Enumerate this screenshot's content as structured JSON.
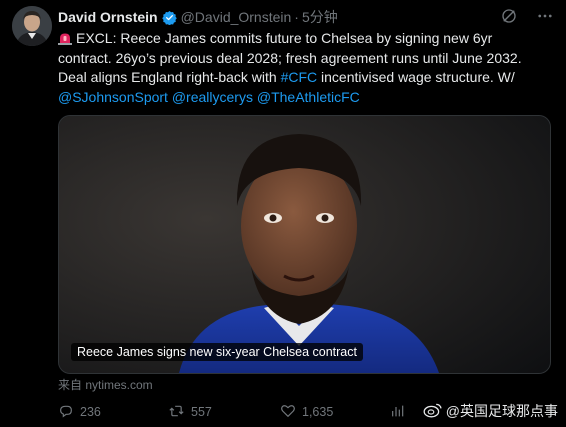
{
  "author": {
    "name": "David Ornstein",
    "handle": "@David_Ornstein",
    "time": "5分钟"
  },
  "tweet": {
    "line1_after_icon": "EXCL: Reece James commits future to Chelsea by signing new 6yr",
    "line2": "contract. 26yo’s previous deal 2028; fresh agreement runs until June 2032.",
    "line3_before_tag": "Deal aligns England right-back with ",
    "hashtag": "#CFC",
    "line3_after_tag": " incentivised wage structure. W/",
    "mention1": "@SJohnsonSport",
    "mention2": "@reallycerys",
    "mention3": "@TheAthleticFC"
  },
  "media": {
    "caption": "Reece James signs new six-year Chelsea contract"
  },
  "source_text": "来自 nytimes.com",
  "actions": {
    "replies": "236",
    "reposts": "557",
    "likes": "1,635"
  },
  "watermark_text": "@英国足球那点事",
  "colors": {
    "background": "#000000",
    "link": "#1d9bf0",
    "muted": "#71767b",
    "verified": "#1d9bf0"
  },
  "icons": [
    "siren-icon",
    "verified-icon",
    "grok-icon",
    "more-icon",
    "reply-icon",
    "repost-icon",
    "like-icon",
    "views-icon",
    "weibo-icon"
  ]
}
